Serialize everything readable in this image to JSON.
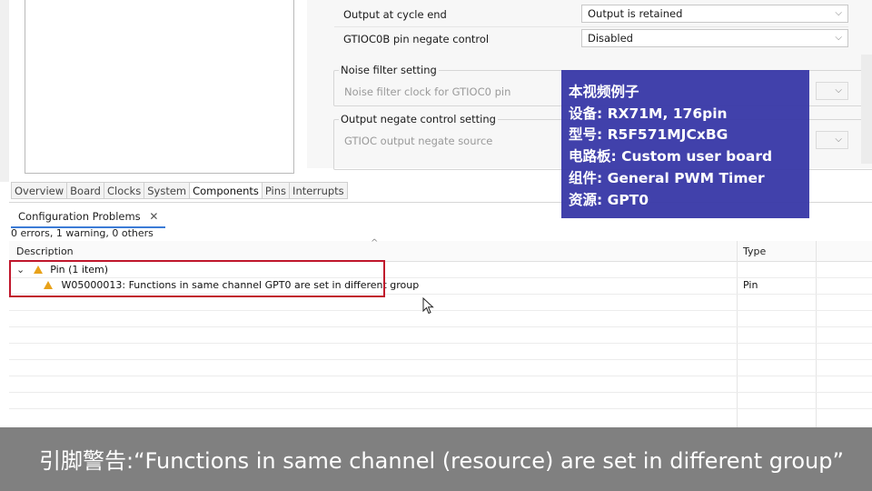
{
  "properties": {
    "output_cycle_end": {
      "label": "Output at cycle end",
      "value": "Output is retained"
    },
    "negate_control": {
      "label": "GTIOC0B pin negate control",
      "value": "Disabled"
    },
    "noise_group": {
      "title": "Noise filter setting",
      "clock_label": "Noise filter clock for GTIOC0 pin"
    },
    "negate_group": {
      "title": "Output negate control setting",
      "source_label": "GTIOC output negate source"
    }
  },
  "tabs": [
    "Overview",
    "Board",
    "Clocks",
    "System",
    "Components",
    "Pins",
    "Interrupts"
  ],
  "active_tab": "Components",
  "problems": {
    "view_title": "Configuration Problems",
    "summary": "0 errors, 1 warning, 0 others",
    "columns": {
      "description": "Description",
      "type": "Type"
    },
    "group": {
      "label": "Pin (1 item)"
    },
    "item": {
      "text": "W05000013: Functions in same channel GPT0 are set in different group",
      "type": "Pin"
    }
  },
  "info_box": {
    "lines": [
      "本视频例子",
      "设备: RX71M, 176pin",
      "型号: R5F571MJCxBG",
      "电路板: Custom user board",
      "组件: General PWM Timer",
      "资源: GPT0"
    ],
    "background": "#3a3aa8"
  },
  "caption": "引脚警告:“Functions in same channel (resource) are set in different group”",
  "colors": {
    "highlight_box": "#c0172c",
    "warning_icon": "#e8a21a"
  }
}
